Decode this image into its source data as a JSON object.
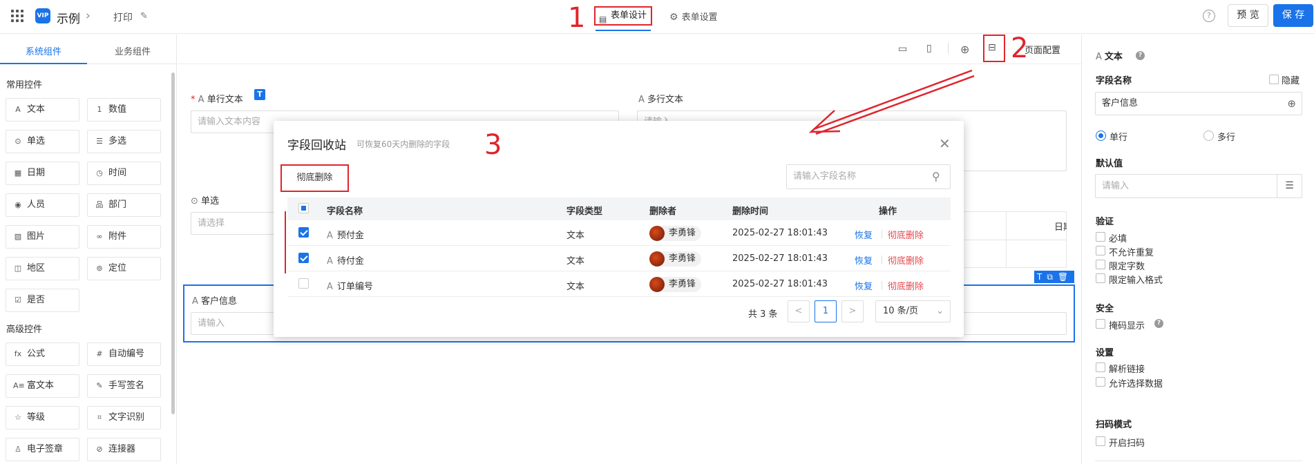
{
  "topbar": {
    "app_logo": "VIP",
    "app_name": "示例",
    "breadcrumb_print": "打印",
    "tab_design": "表单设计",
    "tab_settings": "表单设置",
    "preview": "预 览",
    "save": "保 存"
  },
  "annotations": [
    "1",
    "2",
    "3"
  ],
  "left": {
    "tabs": [
      "系统组件",
      "业务组件"
    ],
    "section_common": "常用控件",
    "section_advanced": "高级控件",
    "common": [
      {
        "icon": "A",
        "label": "文本"
      },
      {
        "icon": "1",
        "label": "数值"
      },
      {
        "icon": "⊙",
        "label": "单选"
      },
      {
        "icon": "☰",
        "label": "多选"
      },
      {
        "icon": "▦",
        "label": "日期"
      },
      {
        "icon": "◷",
        "label": "时间"
      },
      {
        "icon": "◉",
        "label": "人员"
      },
      {
        "icon": "品",
        "label": "部门"
      },
      {
        "icon": "▨",
        "label": "图片"
      },
      {
        "icon": "∞",
        "label": "附件"
      },
      {
        "icon": "◫",
        "label": "地区"
      },
      {
        "icon": "⊚",
        "label": "定位"
      },
      {
        "icon": "☑",
        "label": "是否"
      }
    ],
    "advanced": [
      {
        "icon": "fx",
        "label": "公式"
      },
      {
        "icon": "#",
        "label": "自动编号"
      },
      {
        "icon": "A≡",
        "label": "富文本"
      },
      {
        "icon": "✎",
        "label": "手写签名"
      },
      {
        "icon": "☆",
        "label": "等级"
      },
      {
        "icon": "⌗",
        "label": "文字识别"
      },
      {
        "icon": "♙",
        "label": "电子签章"
      },
      {
        "icon": "⊘",
        "label": "连接器"
      }
    ]
  },
  "canvas": {
    "page_config": "页面配置",
    "field_single_text": "单行文本",
    "field_single_text_placeholder": "请输入文本内容",
    "field_multi_text": "多行文本",
    "field_multi_placeholder": "请输入",
    "field_radio": "单选",
    "field_radio_placeholder": "请选择",
    "field_customer": "客户信息",
    "field_customer_placeholder": "请输入",
    "table_col_date": "日期"
  },
  "modal": {
    "title": "字段回收站",
    "subtitle": "可恢复60天内删除的字段",
    "purge_button": "彻底删除",
    "search_placeholder": "请输入字段名称",
    "columns": [
      "字段名称",
      "字段类型",
      "删除者",
      "删除时间",
      "操作"
    ],
    "rows": [
      {
        "checked": true,
        "name": "预付金",
        "type": "文本",
        "deleter": "李勇锋",
        "time": "2025-02-27 18:01:43",
        "restore": "恢复",
        "purge": "彻底删除"
      },
      {
        "checked": true,
        "name": "待付金",
        "type": "文本",
        "deleter": "李勇锋",
        "time": "2025-02-27 18:01:43",
        "restore": "恢复",
        "purge": "彻底删除"
      },
      {
        "checked": false,
        "name": "订单编号",
        "type": "文本",
        "deleter": "李勇锋",
        "time": "2025-02-27 18:01:43",
        "restore": "恢复",
        "purge": "彻底删除"
      }
    ],
    "total": "共 3 条",
    "prev": "<",
    "current_page": "1",
    "next": ">",
    "page_size": "10 条/页"
  },
  "right": {
    "header": "文本",
    "field_name_label": "字段名称",
    "hidden_label": "隐藏",
    "field_name_value": "客户信息",
    "single_line": "单行",
    "multi_line": "多行",
    "default_label": "默认值",
    "default_placeholder": "请输入",
    "validation": "验证",
    "required": "必填",
    "no_duplicate": "不允许重复",
    "limit_chars": "限定字数",
    "limit_format": "限定输入格式",
    "security": "安全",
    "mask_display": "掩码显示",
    "settings": "设置",
    "parse_link": "解析链接",
    "allow_select": "允许选择数据",
    "scan_mode": "扫码模式",
    "enable_scan": "开启扫码"
  }
}
